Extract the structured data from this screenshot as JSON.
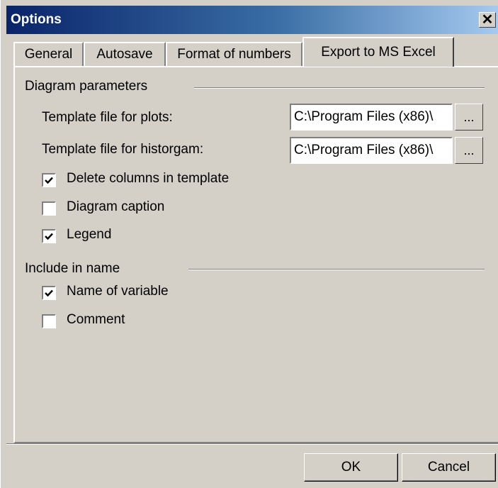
{
  "window": {
    "title": "Options",
    "close_glyph": "✕"
  },
  "tabs": [
    {
      "label": "General"
    },
    {
      "label": "Autosave"
    },
    {
      "label": "Format of numbers"
    },
    {
      "label": "Export to MS Excel"
    }
  ],
  "diagram_group": {
    "title": "Diagram parameters",
    "plots_label": "Template file for plots:",
    "plots_value": "C:\\Program Files (x86)\\",
    "histogram_label": "Template file for historgam:",
    "histogram_value": "C:\\Program Files (x86)\\",
    "browse_label": "...",
    "delete_columns": {
      "label": "Delete columns in template",
      "checked": true
    },
    "diagram_caption": {
      "label": "Diagram caption",
      "checked": false
    },
    "legend": {
      "label": "Legend",
      "checked": true
    }
  },
  "name_group": {
    "title": "Include in name",
    "name_of_variable": {
      "label": "Name of variable",
      "checked": true
    },
    "comment": {
      "label": "Comment",
      "checked": false
    }
  },
  "buttons": {
    "ok": "OK",
    "cancel": "Cancel"
  }
}
